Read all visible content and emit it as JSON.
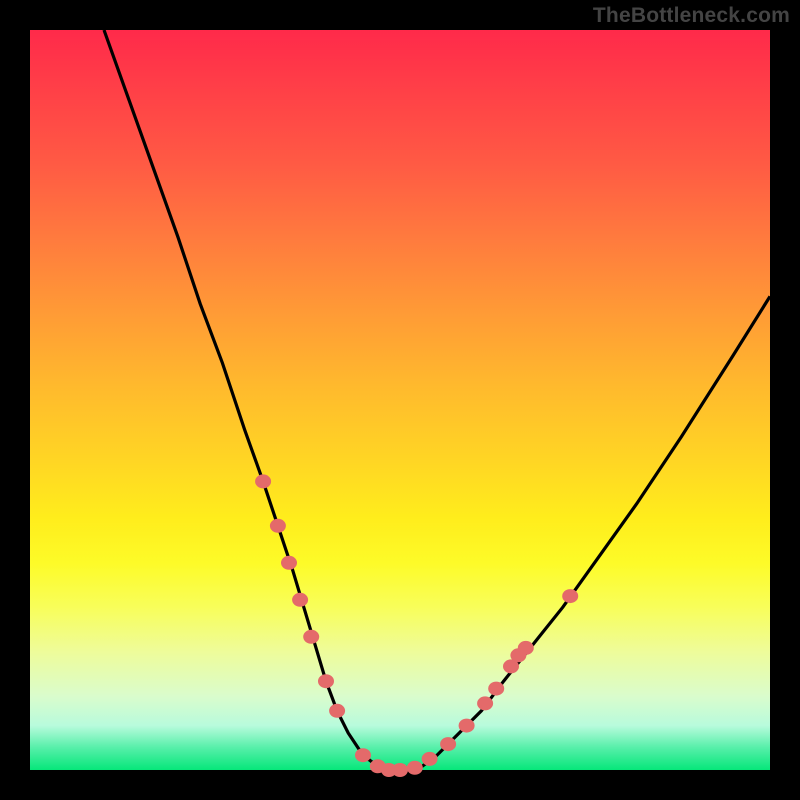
{
  "attribution": "TheBottleneck.com",
  "colors": {
    "top": "#ff2a4a",
    "bottom": "#06e77a",
    "curve": "#000000",
    "markers": "#e46a6a"
  },
  "chart_data": {
    "type": "line",
    "title": "",
    "xlabel": "",
    "ylabel": "",
    "xlim": [
      0,
      100
    ],
    "ylim": [
      0,
      100
    ],
    "x": [
      10,
      15,
      20,
      23,
      26,
      29,
      31.5,
      33.5,
      35.5,
      37,
      38.5,
      40,
      41.5,
      43,
      45,
      47,
      49,
      51,
      53,
      55,
      58,
      61,
      64,
      68,
      72,
      77,
      82,
      88,
      95,
      100
    ],
    "values": [
      100,
      86,
      72,
      63,
      55,
      46,
      39,
      33,
      27,
      22,
      17,
      12,
      8,
      5,
      2,
      0.5,
      0,
      0,
      0.5,
      2,
      5,
      8,
      12,
      17,
      22,
      29,
      36,
      45,
      56,
      64
    ],
    "markers": [
      {
        "x": 31.5,
        "y": 39
      },
      {
        "x": 33.5,
        "y": 33
      },
      {
        "x": 35.0,
        "y": 28
      },
      {
        "x": 36.5,
        "y": 23
      },
      {
        "x": 38.0,
        "y": 18
      },
      {
        "x": 40.0,
        "y": 12
      },
      {
        "x": 41.5,
        "y": 8
      },
      {
        "x": 45.0,
        "y": 2
      },
      {
        "x": 47.0,
        "y": 0.5
      },
      {
        "x": 48.5,
        "y": 0
      },
      {
        "x": 50.0,
        "y": 0
      },
      {
        "x": 52.0,
        "y": 0.3
      },
      {
        "x": 54.0,
        "y": 1.5
      },
      {
        "x": 56.5,
        "y": 3.5
      },
      {
        "x": 59.0,
        "y": 6
      },
      {
        "x": 61.5,
        "y": 9
      },
      {
        "x": 63.0,
        "y": 11
      },
      {
        "x": 65.0,
        "y": 14
      },
      {
        "x": 66.0,
        "y": 15.5
      },
      {
        "x": 67.0,
        "y": 16.5
      },
      {
        "x": 73.0,
        "y": 23.5
      }
    ]
  }
}
